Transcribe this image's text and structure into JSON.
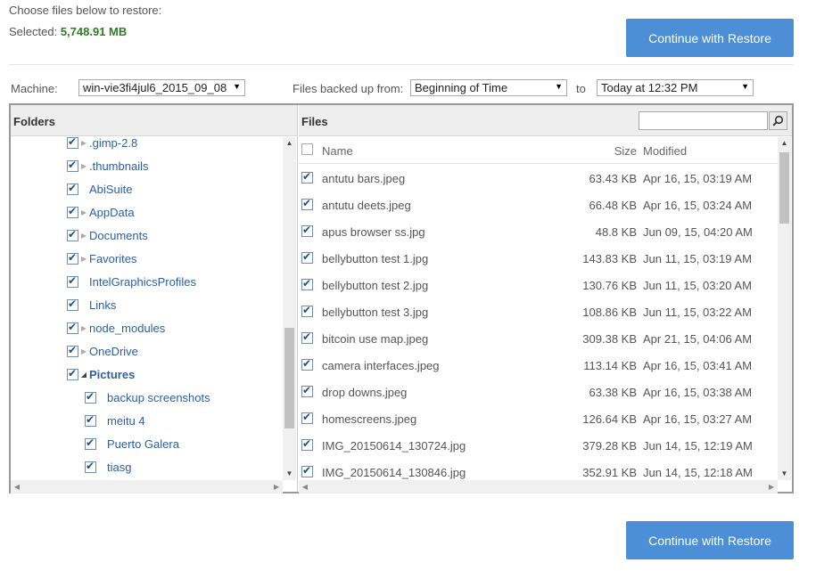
{
  "header": {
    "instruction": "Choose files below to restore:",
    "selected_label": "Selected:",
    "selected_value": "5,748.91 MB",
    "continue_label": "Continue with Restore"
  },
  "filters": {
    "machine_label": "Machine:",
    "machine_value": "win-vie3fi4jul6_2015_09_08",
    "from_label": "Files backed up from:",
    "from_value": "Beginning of Time",
    "to_label": "to",
    "to_value": "Today at 12:32 PM"
  },
  "folders": {
    "title": "Folders",
    "items": [
      {
        "label": ".gimp-2.8",
        "expander": "collapsed",
        "level": 0,
        "checked": true
      },
      {
        "label": ".thumbnails",
        "expander": "collapsed",
        "level": 0,
        "checked": true
      },
      {
        "label": "AbiSuite",
        "expander": "none",
        "level": 0,
        "checked": true
      },
      {
        "label": "AppData",
        "expander": "collapsed",
        "level": 0,
        "checked": true
      },
      {
        "label": "Documents",
        "expander": "collapsed",
        "level": 0,
        "checked": true
      },
      {
        "label": "Favorites",
        "expander": "collapsed",
        "level": 0,
        "checked": true
      },
      {
        "label": "IntelGraphicsProfiles",
        "expander": "none",
        "level": 0,
        "checked": true
      },
      {
        "label": "Links",
        "expander": "none",
        "level": 0,
        "checked": true
      },
      {
        "label": "node_modules",
        "expander": "collapsed",
        "level": 0,
        "checked": true
      },
      {
        "label": "OneDrive",
        "expander": "collapsed",
        "level": 0,
        "checked": true
      },
      {
        "label": "Pictures",
        "expander": "expanded",
        "level": 0,
        "checked": true,
        "selected": true
      },
      {
        "label": "backup screenshots",
        "expander": "none",
        "level": 1,
        "checked": true
      },
      {
        "label": "meitu 4",
        "expander": "none",
        "level": 1,
        "checked": true
      },
      {
        "label": "Puerto Galera",
        "expander": "none",
        "level": 1,
        "checked": true
      },
      {
        "label": "tiasg",
        "expander": "none",
        "level": 1,
        "checked": true
      }
    ]
  },
  "files": {
    "title": "Files",
    "search_placeholder": "",
    "columns": {
      "name": "Name",
      "size": "Size",
      "modified": "Modified"
    },
    "rows": [
      {
        "name": "antutu bars.jpeg",
        "size": "63.43 KB",
        "modified": "Apr 16, 15, 03:19 AM",
        "checked": true
      },
      {
        "name": "antutu deets.jpeg",
        "size": "66.48 KB",
        "modified": "Apr 16, 15, 03:24 AM",
        "checked": true
      },
      {
        "name": "apus browser ss.jpg",
        "size": "48.8 KB",
        "modified": "Jun 09, 15, 04:20 AM",
        "checked": true
      },
      {
        "name": "bellybutton test 1.jpg",
        "size": "143.83 KB",
        "modified": "Jun 11, 15, 03:19 AM",
        "checked": true
      },
      {
        "name": "bellybutton test 2.jpg",
        "size": "130.76 KB",
        "modified": "Jun 11, 15, 03:20 AM",
        "checked": true
      },
      {
        "name": "bellybutton test 3.jpg",
        "size": "108.86 KB",
        "modified": "Jun 11, 15, 03:22 AM",
        "checked": true
      },
      {
        "name": "bitcoin use map.jpeg",
        "size": "309.38 KB",
        "modified": "Apr 21, 15, 04:06 AM",
        "checked": true
      },
      {
        "name": "camera interfaces.jpeg",
        "size": "113.14 KB",
        "modified": "Apr 16, 15, 03:41 AM",
        "checked": true
      },
      {
        "name": "drop downs.jpeg",
        "size": "63.38 KB",
        "modified": "Apr 16, 15, 03:38 AM",
        "checked": true
      },
      {
        "name": "homescreens.jpeg",
        "size": "126.64 KB",
        "modified": "Apr 16, 15, 03:27 AM",
        "checked": true
      },
      {
        "name": "IMG_20150614_130724.jpg",
        "size": "379.28 KB",
        "modified": "Jun 14, 15, 12:19 AM",
        "checked": true
      },
      {
        "name": "IMG_20150614_130846.jpg",
        "size": "352.91 KB",
        "modified": "Jun 14, 15, 12:18 AM",
        "checked": true
      }
    ]
  },
  "colors": {
    "accent": "#4d8fd6",
    "selected_size": "#2e7d1f",
    "folder_link": "#2f5f9e"
  }
}
